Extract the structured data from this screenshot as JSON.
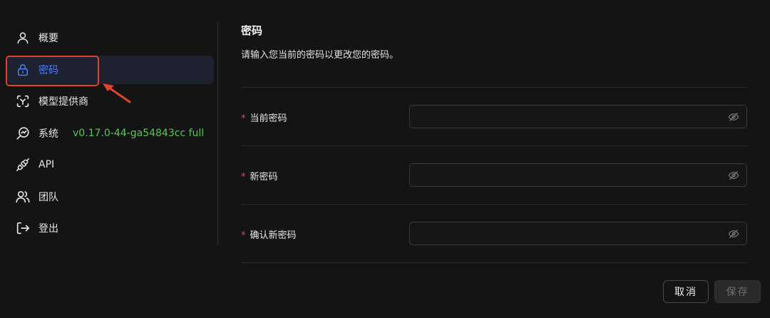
{
  "sidebar": {
    "items": [
      {
        "label": "概要",
        "icon": "user-icon"
      },
      {
        "label": "密码",
        "icon": "lock-icon",
        "active": true
      },
      {
        "label": "模型提供商",
        "icon": "model-provider-icon"
      },
      {
        "label": "系统",
        "icon": "system-gauge-icon",
        "version": "v0.17.0-44-ga54843cc full"
      },
      {
        "label": "API",
        "icon": "plug-icon"
      },
      {
        "label": "团队",
        "icon": "team-icon"
      },
      {
        "label": "登出",
        "icon": "logout-icon"
      }
    ]
  },
  "main": {
    "title": "密码",
    "subtitle": "请输入您当前的密码以更改您的密码。",
    "fields": [
      {
        "label": "当前密码",
        "required": "*",
        "value": ""
      },
      {
        "label": "新密码",
        "required": "*",
        "value": ""
      },
      {
        "label": "确认新密码",
        "required": "*",
        "value": ""
      }
    ]
  },
  "buttons": {
    "cancel": "取消",
    "save": "保存"
  },
  "colors": {
    "accent": "#4f7ef8",
    "version": "#5ec35a",
    "annotation": "#e2412b",
    "required": "#e5484d"
  }
}
